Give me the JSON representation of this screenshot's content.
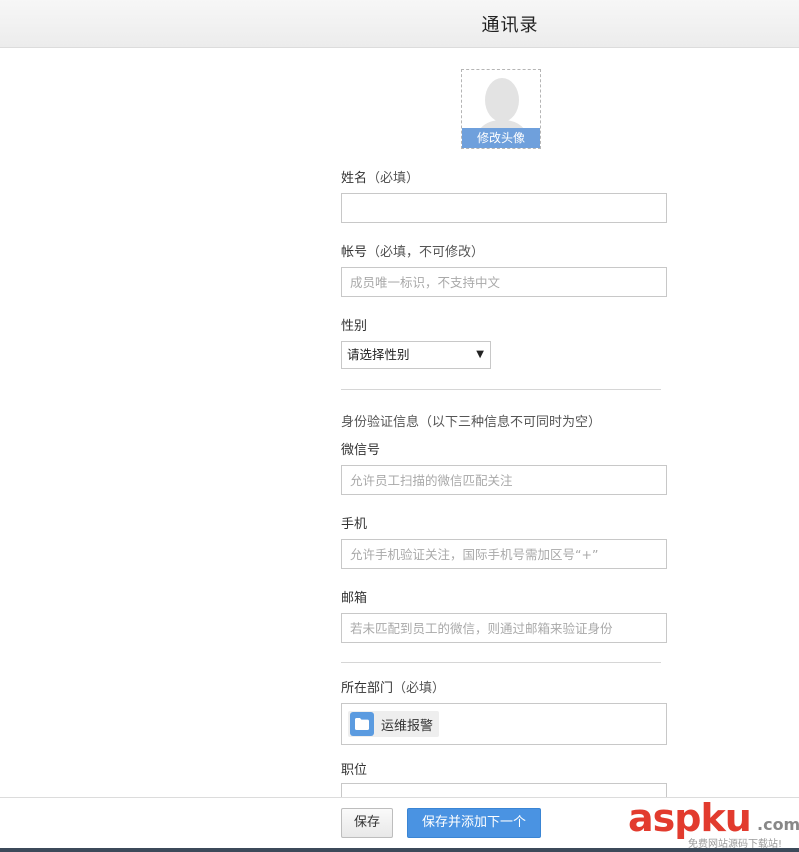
{
  "header": {
    "title": "通讯录"
  },
  "avatar": {
    "edit_label": "修改头像"
  },
  "form": {
    "name": {
      "label": "姓名",
      "hint": "（必填）",
      "value": "",
      "placeholder": ""
    },
    "account": {
      "label": "帐号",
      "hint": "（必填，不可修改）",
      "value": "",
      "placeholder": "成员唯一标识，不支持中文"
    },
    "gender": {
      "label": "性别",
      "selected": "请选择性别"
    },
    "identity_note": "身份验证信息（以下三种信息不可同时为空）",
    "wechat": {
      "label": "微信号",
      "value": "",
      "placeholder": "允许员工扫描的微信匹配关注"
    },
    "phone": {
      "label": "手机",
      "value": "",
      "placeholder": "允许手机验证关注，国际手机号需加区号“+”"
    },
    "email": {
      "label": "邮箱",
      "value": "",
      "placeholder": "若未匹配到员工的微信，则通过邮箱来验证身份"
    },
    "department": {
      "label": "所在部门",
      "hint": "（必填）",
      "tags": [
        "运维报警"
      ]
    },
    "position": {
      "label": "职位"
    }
  },
  "footer": {
    "save_label": "保存",
    "save_next_label": "保存并添加下一个"
  },
  "watermark": {
    "main": "aspku",
    "tld": ".com",
    "sub": "免费网站源码下载站!"
  },
  "colors": {
    "primary": "#4a93e2",
    "avatar_band": "#6fa0dc",
    "folder_icon": "#5b9be0",
    "watermark": "#e23b2e"
  },
  "icons": {
    "avatar": "person-silhouette-icon",
    "department": "folder-icon",
    "select_arrow": "caret-down-icon"
  }
}
